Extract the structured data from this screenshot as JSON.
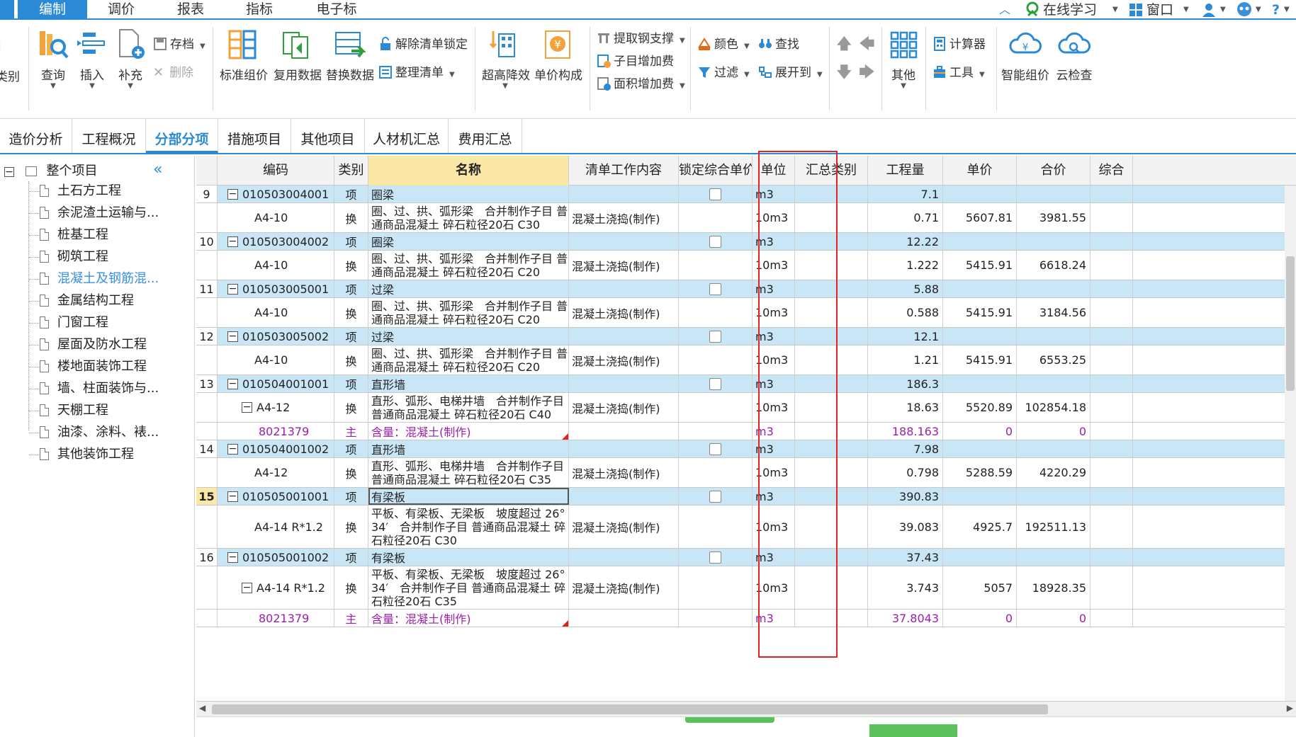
{
  "menu": {
    "tabs": [
      "编制",
      "调价",
      "报表",
      "指标",
      "电子标"
    ],
    "active": 0,
    "online_study": "在线学习",
    "window": "窗口",
    "help": "?"
  },
  "ribbon": {
    "category": "类别",
    "query": "查询",
    "insert": "插入",
    "supplement": "补充",
    "save": "存档",
    "delete": "删除",
    "standard_pricing": "标准组价",
    "reuse_data": "复用数据",
    "replace_data": "替换数据",
    "unlock_list": "解除清单锁定",
    "organize_list": "整理清单",
    "height_reduction": "超高降效",
    "unit_price_composition": "单价构成",
    "extract_rebar": "提取钢支撑",
    "subitem_increase": "子目增加费",
    "area_increase": "面积增加费",
    "color": "颜色",
    "find": "查找",
    "filter": "过滤",
    "expand_to": "展开到",
    "other": "其他",
    "calculator": "计算器",
    "tools": "工具",
    "smart_pricing": "智能组价",
    "cloud_check": "云检查"
  },
  "subtabs": {
    "items": [
      "造价分析",
      "工程概况",
      "分部分项",
      "措施项目",
      "其他项目",
      "人材机汇总",
      "费用汇总"
    ],
    "active": 2
  },
  "tree": {
    "root": "整个项目",
    "items": [
      "土石方工程",
      "余泥渣土运输与...",
      "桩基工程",
      "砌筑工程",
      "混凝土及钢筋混...",
      "金属结构工程",
      "门窗工程",
      "屋面及防水工程",
      "楼地面装饰工程",
      "墙、柱面装饰与...",
      "天棚工程",
      "油漆、涂料、裱...",
      "其他装饰工程"
    ],
    "selected": 4
  },
  "grid": {
    "headers": [
      "编码",
      "类别",
      "名称",
      "清单工作内容",
      "锁定综合单价",
      "单位",
      "汇总类别",
      "工程量",
      "单价",
      "合价",
      "综合"
    ],
    "rows": [
      {
        "no": "9",
        "code": "010503004001",
        "type": "项",
        "name": "圈梁",
        "content": "",
        "unit": "m3",
        "qty": "7.1",
        "price": "",
        "total": ""
      },
      {
        "no": "",
        "code": "A4-10",
        "type": "换",
        "name": "圈、过、拱、弧形梁　合并制作子目 普通商品混凝土 碎石粒径20石 C30",
        "content": "混凝土浇捣(制作)",
        "unit": "10m3",
        "qty": "0.71",
        "price": "5607.81",
        "total": "3981.55"
      },
      {
        "no": "10",
        "code": "010503004002",
        "type": "项",
        "name": "圈梁",
        "content": "",
        "unit": "m3",
        "qty": "12.22",
        "price": "",
        "total": ""
      },
      {
        "no": "",
        "code": "A4-10",
        "type": "换",
        "name": "圈、过、拱、弧形梁　合并制作子目 普通商品混凝土 碎石粒径20石 C20",
        "content": "混凝土浇捣(制作)",
        "unit": "10m3",
        "qty": "1.222",
        "price": "5415.91",
        "total": "6618.24"
      },
      {
        "no": "11",
        "code": "010503005001",
        "type": "项",
        "name": "过梁",
        "content": "",
        "unit": "m3",
        "qty": "5.88",
        "price": "",
        "total": ""
      },
      {
        "no": "",
        "code": "A4-10",
        "type": "换",
        "name": "圈、过、拱、弧形梁　合并制作子目 普通商品混凝土 碎石粒径20石 C20",
        "content": "混凝土浇捣(制作)",
        "unit": "10m3",
        "qty": "0.588",
        "price": "5415.91",
        "total": "3184.56"
      },
      {
        "no": "12",
        "code": "010503005002",
        "type": "项",
        "name": "过梁",
        "content": "",
        "unit": "m3",
        "qty": "12.1",
        "price": "",
        "total": ""
      },
      {
        "no": "",
        "code": "A4-10",
        "type": "换",
        "name": "圈、过、拱、弧形梁　合并制作子目 普通商品混凝土 碎石粒径20石 C20",
        "content": "混凝土浇捣(制作)",
        "unit": "10m3",
        "qty": "1.21",
        "price": "5415.91",
        "total": "6553.25"
      },
      {
        "no": "13",
        "code": "010504001001",
        "type": "项",
        "name": "直形墙",
        "content": "",
        "unit": "m3",
        "qty": "186.3",
        "price": "",
        "total": ""
      },
      {
        "no": "",
        "code": "A4-12",
        "type": "换",
        "name": "直形、弧形、电梯井墙　合并制作子目 普通商品混凝土 碎石粒径20石 C40",
        "content": "混凝土浇捣(制作)",
        "unit": "10m3",
        "qty": "18.63",
        "price": "5520.89",
        "total": "102854.18"
      },
      {
        "no": "",
        "code": "8021379",
        "type": "主",
        "name": "含量：混凝土(制作)",
        "content": "",
        "unit": "m3",
        "qty": "188.163",
        "price": "0",
        "total": "0"
      },
      {
        "no": "14",
        "code": "010504001002",
        "type": "项",
        "name": "直形墙",
        "content": "",
        "unit": "m3",
        "qty": "7.98",
        "price": "",
        "total": ""
      },
      {
        "no": "",
        "code": "A4-12",
        "type": "换",
        "name": "直形、弧形、电梯井墙　合并制作子目 普通商品混凝土 碎石粒径20石 C35",
        "content": "混凝土浇捣(制作)",
        "unit": "10m3",
        "qty": "0.798",
        "price": "5288.59",
        "total": "4220.29"
      },
      {
        "no": "15",
        "code": "010505001001",
        "type": "项",
        "name": "有梁板",
        "content": "",
        "unit": "m3",
        "qty": "390.83",
        "price": "",
        "total": ""
      },
      {
        "no": "",
        "code": "A4-14 R*1.2",
        "type": "换",
        "name": "平板、有梁板、无梁板　坡度超过 26° 34′　合并制作子目 普通商品混凝土 碎石粒径20石 C30",
        "content": "混凝土浇捣(制作)",
        "unit": "10m3",
        "qty": "39.083",
        "price": "4925.7",
        "total": "192511.13"
      },
      {
        "no": "16",
        "code": "010505001002",
        "type": "项",
        "name": "有梁板",
        "content": "",
        "unit": "m3",
        "qty": "37.43",
        "price": "",
        "total": ""
      },
      {
        "no": "",
        "code": "A4-14 R*1.2",
        "type": "换",
        "name": "平板、有梁板、无梁板　坡度超过 26° 34′　合并制作子目 普通商品混凝土 碎石粒径20石 C35",
        "content": "混凝土浇捣(制作)",
        "unit": "10m3",
        "qty": "3.743",
        "price": "5057",
        "total": "18928.35"
      },
      {
        "no": "",
        "code": "8021379",
        "type": "主",
        "name": "含量：混凝土(制作)",
        "content": "",
        "unit": "m3",
        "qty": "37.8043",
        "price": "0",
        "total": "0"
      }
    ]
  },
  "colors": {
    "accent": "#2b8ad6",
    "row_blue": "#c9e6f7",
    "name_header": "#fbe7a6",
    "highlight_box": "#e02424",
    "main_material": "#9b1fa8"
  }
}
